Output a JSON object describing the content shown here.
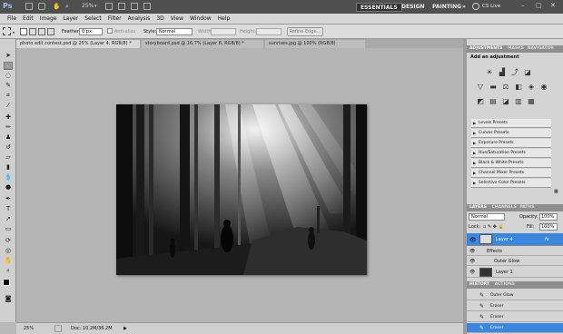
{
  "app": {
    "logo": "Ps",
    "zoom": "25%"
  },
  "menu": [
    "File",
    "Edit",
    "Image",
    "Layer",
    "Select",
    "Filter",
    "Analysis",
    "3D",
    "View",
    "Window",
    "Help"
  ],
  "workspace": {
    "essentials": "ESSENTIALS",
    "design": "DESIGN",
    "painting": "PAINTING",
    "more": "»",
    "cslive": "CS Live"
  },
  "options": {
    "feather_label": "Feather:",
    "feather_value": "0 px",
    "antialias": "Anti-alias",
    "style_label": "Style:",
    "style_value": "Normal",
    "width_label": "Width:",
    "height_label": "Height:",
    "refine": "Refine Edge..."
  },
  "tabs": [
    {
      "label": "photo edit contest.psd @ 25% (Layer 4, RGB/8) *"
    },
    {
      "label": "storyboard.psd @ 16.7% (Layer 8, RGB/8) *"
    },
    {
      "label": "sunrises.jpg @ 100% (RGB/8)"
    }
  ],
  "status": {
    "zoom": "25%",
    "doc": "Doc: 10.2M/36.2M"
  },
  "adjustments": {
    "tab1": "ADJUSTMENTS",
    "tab2": "MASKS",
    "tab3": "NAVIGATOR",
    "title": "Add an adjustment",
    "presets": [
      "Levels Presets",
      "Curves Presets",
      "Exposure Presets",
      "Hue/Saturation Presets",
      "Black & White Presets",
      "Channel Mixer Presets",
      "Selective Color Presets"
    ]
  },
  "layers": {
    "tab1": "LAYERS",
    "tab2": "CHANNELS",
    "tab3": "PATHS",
    "blend": "Normal",
    "opacity_label": "Opacity:",
    "opacity": "100%",
    "lock_label": "Lock:",
    "fill_label": "Fill:",
    "fill": "100%",
    "rows": [
      {
        "name": "Layer 4",
        "fx": "fx"
      },
      {
        "name": "Effects"
      },
      {
        "name": "Outer Glow"
      },
      {
        "name": "Layer 1"
      }
    ]
  },
  "history": {
    "tab1": "HISTORY",
    "tab2": "ACTIONS",
    "items": [
      "Outer Glow",
      "Eraser",
      "Eraser",
      "Eraser"
    ]
  },
  "colors": {
    "accent": "#3d8ee6",
    "selected": "#3b87e0"
  }
}
